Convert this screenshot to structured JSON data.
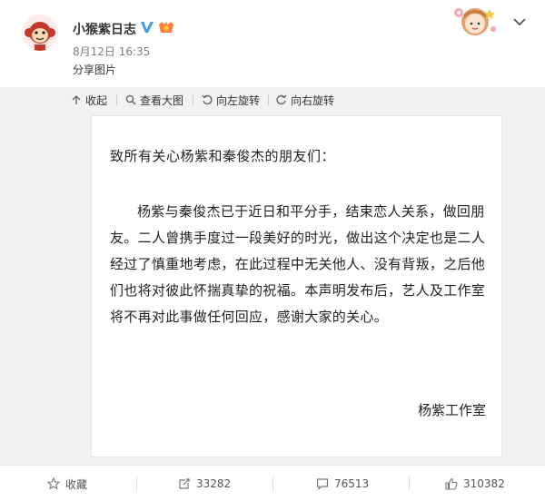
{
  "post": {
    "user_name": "小猴紫日志",
    "time": "8月12日 16:35",
    "text": "分享图片"
  },
  "toolbar": {
    "collapse_label": "收起",
    "view_large_label": "查看大图",
    "rotate_left_label": "向左旋转",
    "rotate_right_label": "向右旋转"
  },
  "letter": {
    "greeting": "致所有关心杨紫和秦俊杰的朋友们：",
    "body": "杨紫与秦俊杰已于近日和平分手，结束恋人关系，做回朋友。二人曾携手度过一段美好的时光，做出这个决定也是二人经过了慎重地考虑，在此过程中无关他人、没有背叛，之后他们也将对彼此怀揣真挚的祝福。本声明发布后，艺人及工作室将不再对此事做任何回应，感谢大家的关心。",
    "signature": "杨紫工作室"
  },
  "footer": {
    "favorite_label": "收藏",
    "repost_count": "33282",
    "comment_count": "76513",
    "like_count": "310382"
  },
  "colors": {
    "accent_orange": "#ff8140",
    "verified_blue": "#3d9df0"
  },
  "icons": [
    "monkey-avatar-icon",
    "verified-icon",
    "member-badge-icon",
    "chevron-down-icon",
    "collapse-icon",
    "zoom-icon",
    "rotate-left-icon",
    "rotate-right-icon",
    "star-icon",
    "repost-icon",
    "comment-icon",
    "like-icon"
  ]
}
